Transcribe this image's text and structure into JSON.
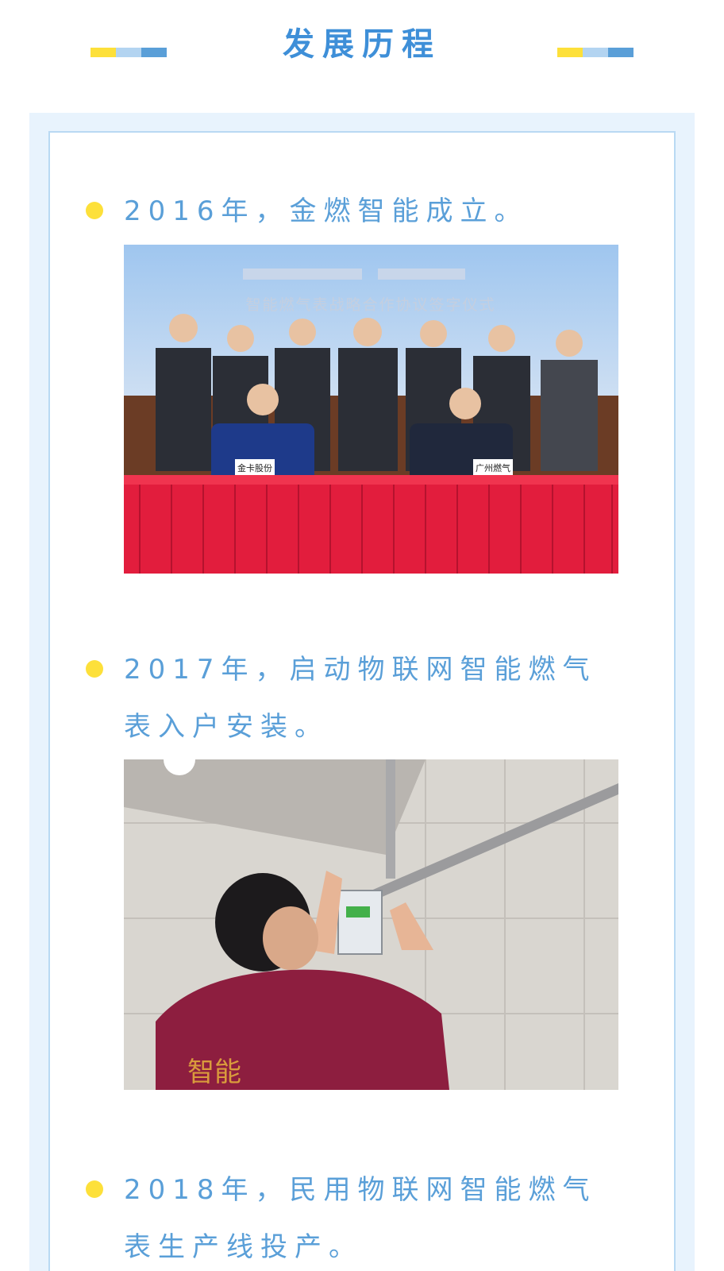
{
  "header": {
    "title": "发展历程"
  },
  "colors": {
    "accent_blue": "#3e8fd8",
    "text_blue": "#5a9fd8",
    "dot_yellow": "#fde03a",
    "frame_bg": "#e8f3fd",
    "frame_border": "#b9d9f3",
    "deco_yellow": "#fde03a",
    "deco_lightblue": "#b3d4f1",
    "deco_blue": "#5a9fd8"
  },
  "timeline": [
    {
      "text": "2016年，金燃智能成立。",
      "photo_icon": "signing-ceremony-photo",
      "photo_texts": {
        "banner": "智能燃气表战略合作协议签字仪式",
        "left_placard": "金卡股份",
        "right_placard": "广州燃气"
      }
    },
    {
      "text": "2017年，启动物联网智能燃气表入户安装。",
      "photo_icon": "meter-installation-photo",
      "photo_texts": {
        "shirt": "智能"
      }
    },
    {
      "text": "2018年，民用物联网智能燃气表生产线投产。"
    }
  ]
}
